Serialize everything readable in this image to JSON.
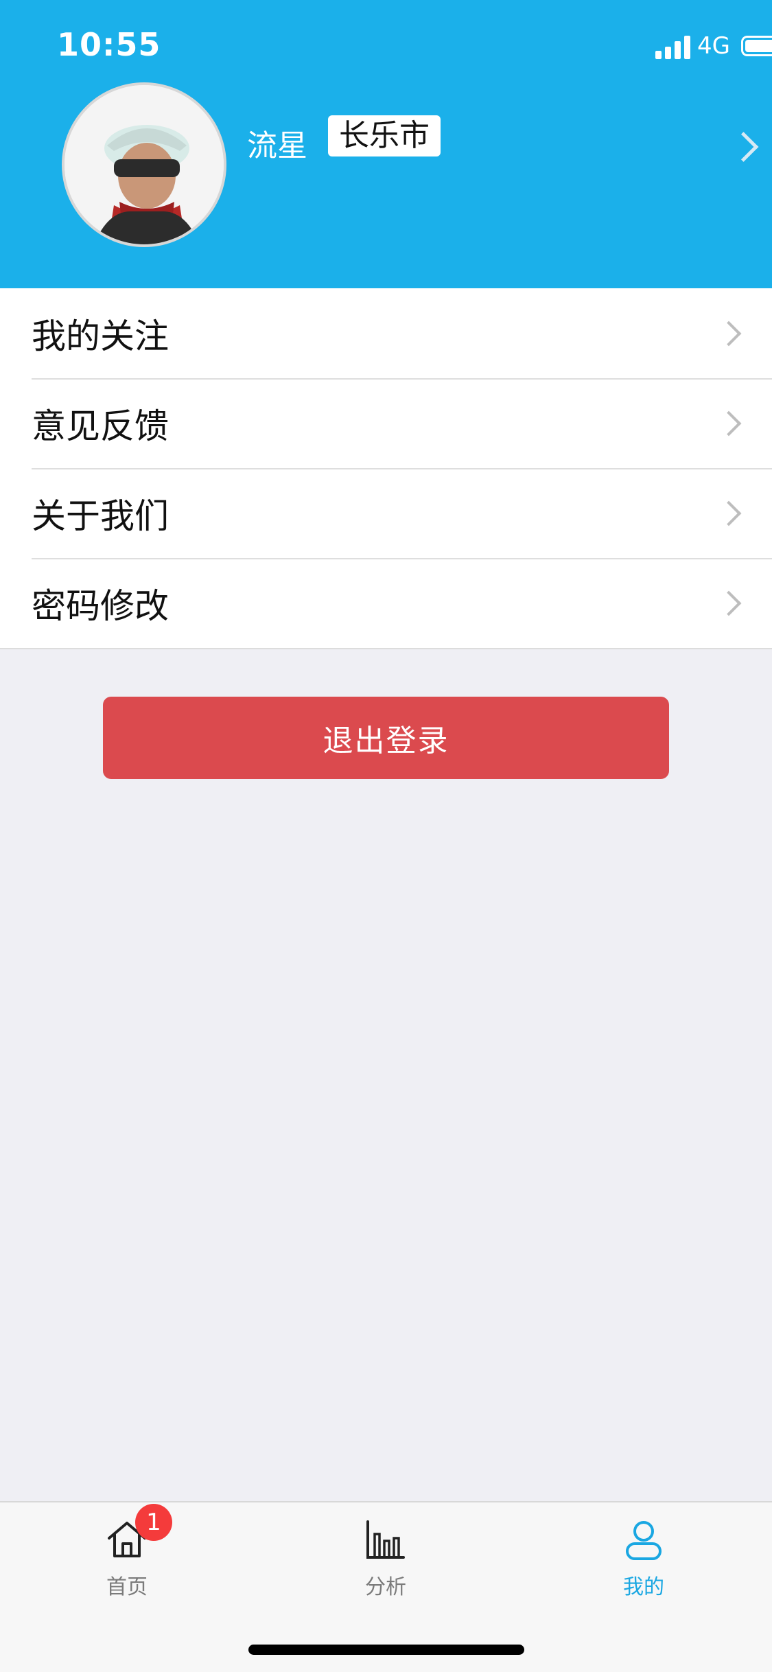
{
  "status": {
    "time": "10:55",
    "network": "4G"
  },
  "profile": {
    "name": "流星",
    "city": "长乐市"
  },
  "menu": {
    "items": [
      {
        "label": "我的关注"
      },
      {
        "label": "意见反馈"
      },
      {
        "label": "关于我们"
      },
      {
        "label": "密码修改"
      }
    ]
  },
  "logout": {
    "label": "退出登录"
  },
  "tabs": [
    {
      "label": "首页",
      "badge": "1",
      "icon": "home-icon"
    },
    {
      "label": "分析",
      "icon": "chart-icon"
    },
    {
      "label": "我的",
      "icon": "user-icon"
    }
  ],
  "colors": {
    "header_bg": "#1bb0ea",
    "logout_bg": "#db4a4e",
    "active_tab": "#1aa7e2",
    "badge": "#f43b3b"
  }
}
